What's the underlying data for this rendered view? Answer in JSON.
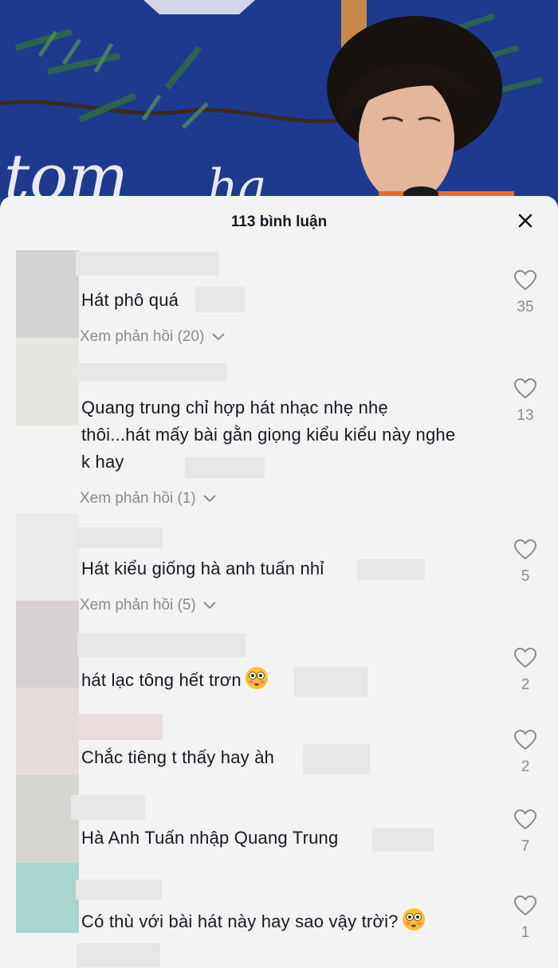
{
  "sheet": {
    "title": "113 bình luận"
  },
  "comments": [
    {
      "text": "Hát phô quá",
      "likes": "35",
      "replies": "Xem phản hồi (20)"
    },
    {
      "text": "Quang trung chỉ hợp hát nhạc nhẹ nhẹ thôi...hát mấy bài gằn giọng kiểu kiểu này nghe k hay",
      "likes": "13",
      "replies": "Xem phản hồi (1)"
    },
    {
      "text": "Hát kiểu giống hà anh tuấn nhỉ",
      "likes": "5",
      "replies": "Xem phản hồi (5)"
    },
    {
      "text": "hát lạc tông hết trơn",
      "likes": "2",
      "emoji": "flushed-face-emoji"
    },
    {
      "text": "Chắc tiêng t thấy hay àh",
      "likes": "2"
    },
    {
      "text": "Hà Anh Tuấn nhập Quang Trung",
      "likes": "7"
    },
    {
      "text": "Có thù với bài hát này hay sao vậy trời?",
      "likes": "1",
      "emoji": "flushed-face-emoji"
    }
  ],
  "icons": {
    "close": "close-icon",
    "like": "heart-outline-icon",
    "chevron": "chevron-down-icon"
  },
  "colors": {
    "text": "#161823",
    "muted": "#8a8a8f",
    "sheet": "#f4f3f3",
    "video_bg": "#1e3a8f"
  }
}
